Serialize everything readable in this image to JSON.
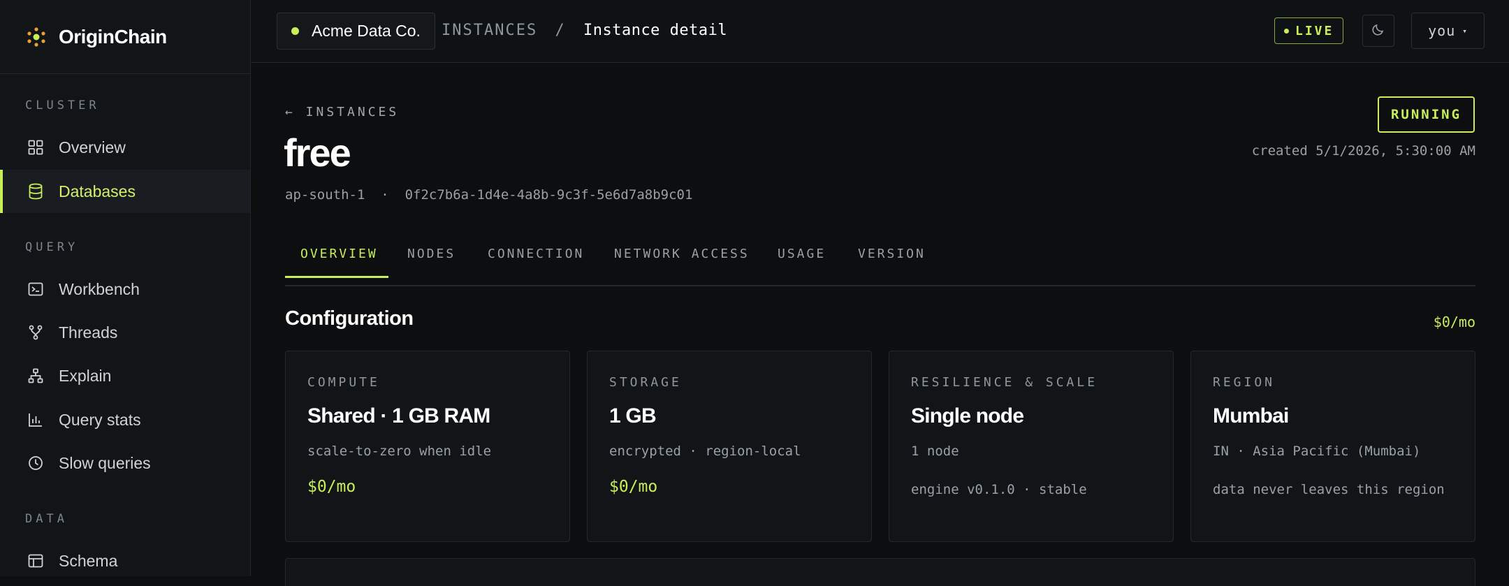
{
  "brand": {
    "name": "OriginChain"
  },
  "sidebar": {
    "sections": [
      {
        "label": "CLUSTER"
      },
      {
        "label": "QUERY"
      },
      {
        "label": "DATA"
      }
    ],
    "items": [
      {
        "label": "Overview",
        "icon": "grid-icon"
      },
      {
        "label": "Databases",
        "icon": "database-icon",
        "active": true
      },
      {
        "label": "Workbench",
        "icon": "terminal-icon"
      },
      {
        "label": "Threads",
        "icon": "branch-icon"
      },
      {
        "label": "Explain",
        "icon": "hierarchy-icon"
      },
      {
        "label": "Query stats",
        "icon": "bar-chart-icon"
      },
      {
        "label": "Slow queries",
        "icon": "clock-icon"
      },
      {
        "label": "Schema",
        "icon": "table-icon"
      }
    ]
  },
  "topbar": {
    "org": "Acme Data Co.",
    "breadcrumb_parent": "INSTANCES",
    "breadcrumb_sep": "/",
    "breadcrumb_current": "Instance detail",
    "live_label": "LIVE",
    "user_label": "you",
    "user_caret": "▾"
  },
  "instance": {
    "back_label": "← INSTANCES",
    "name": "free",
    "subline": "ap-south-1  ·  0f2c7b6a-1d4e-4a8b-9c3f-5e6d7a8b9c01",
    "status": "RUNNING",
    "created": "created 5/1/2026, 5:30:00 AM"
  },
  "tabs": [
    {
      "label": "OVERVIEW",
      "active": true
    },
    {
      "label": "NODES"
    },
    {
      "label": "CONNECTION"
    },
    {
      "label": "NETWORK ACCESS"
    },
    {
      "label": "USAGE"
    },
    {
      "label": "VERSION"
    }
  ],
  "configuration": {
    "title": "Configuration",
    "total_price": "$0/mo",
    "cards": [
      {
        "key": "COMPUTE",
        "value": "Shared · 1 GB RAM",
        "line1": "scale-to-zero when idle",
        "price": "$0/mo"
      },
      {
        "key": "STORAGE",
        "value": "1 GB",
        "line1": "encrypted · region-local",
        "price": "$0/mo"
      },
      {
        "key": "RESILIENCE & SCALE",
        "value": "Single node",
        "line1": "1 node",
        "line2": "engine v0.1.0 · stable"
      },
      {
        "key": "REGION",
        "value": "Mumbai",
        "line1": "IN · Asia Pacific (Mumbai)",
        "line2": "data never leaves this region"
      }
    ]
  },
  "colors": {
    "accent": "#c8ee5a",
    "background": "#0c0e10",
    "panel": "#121518",
    "border": "#24282c"
  }
}
